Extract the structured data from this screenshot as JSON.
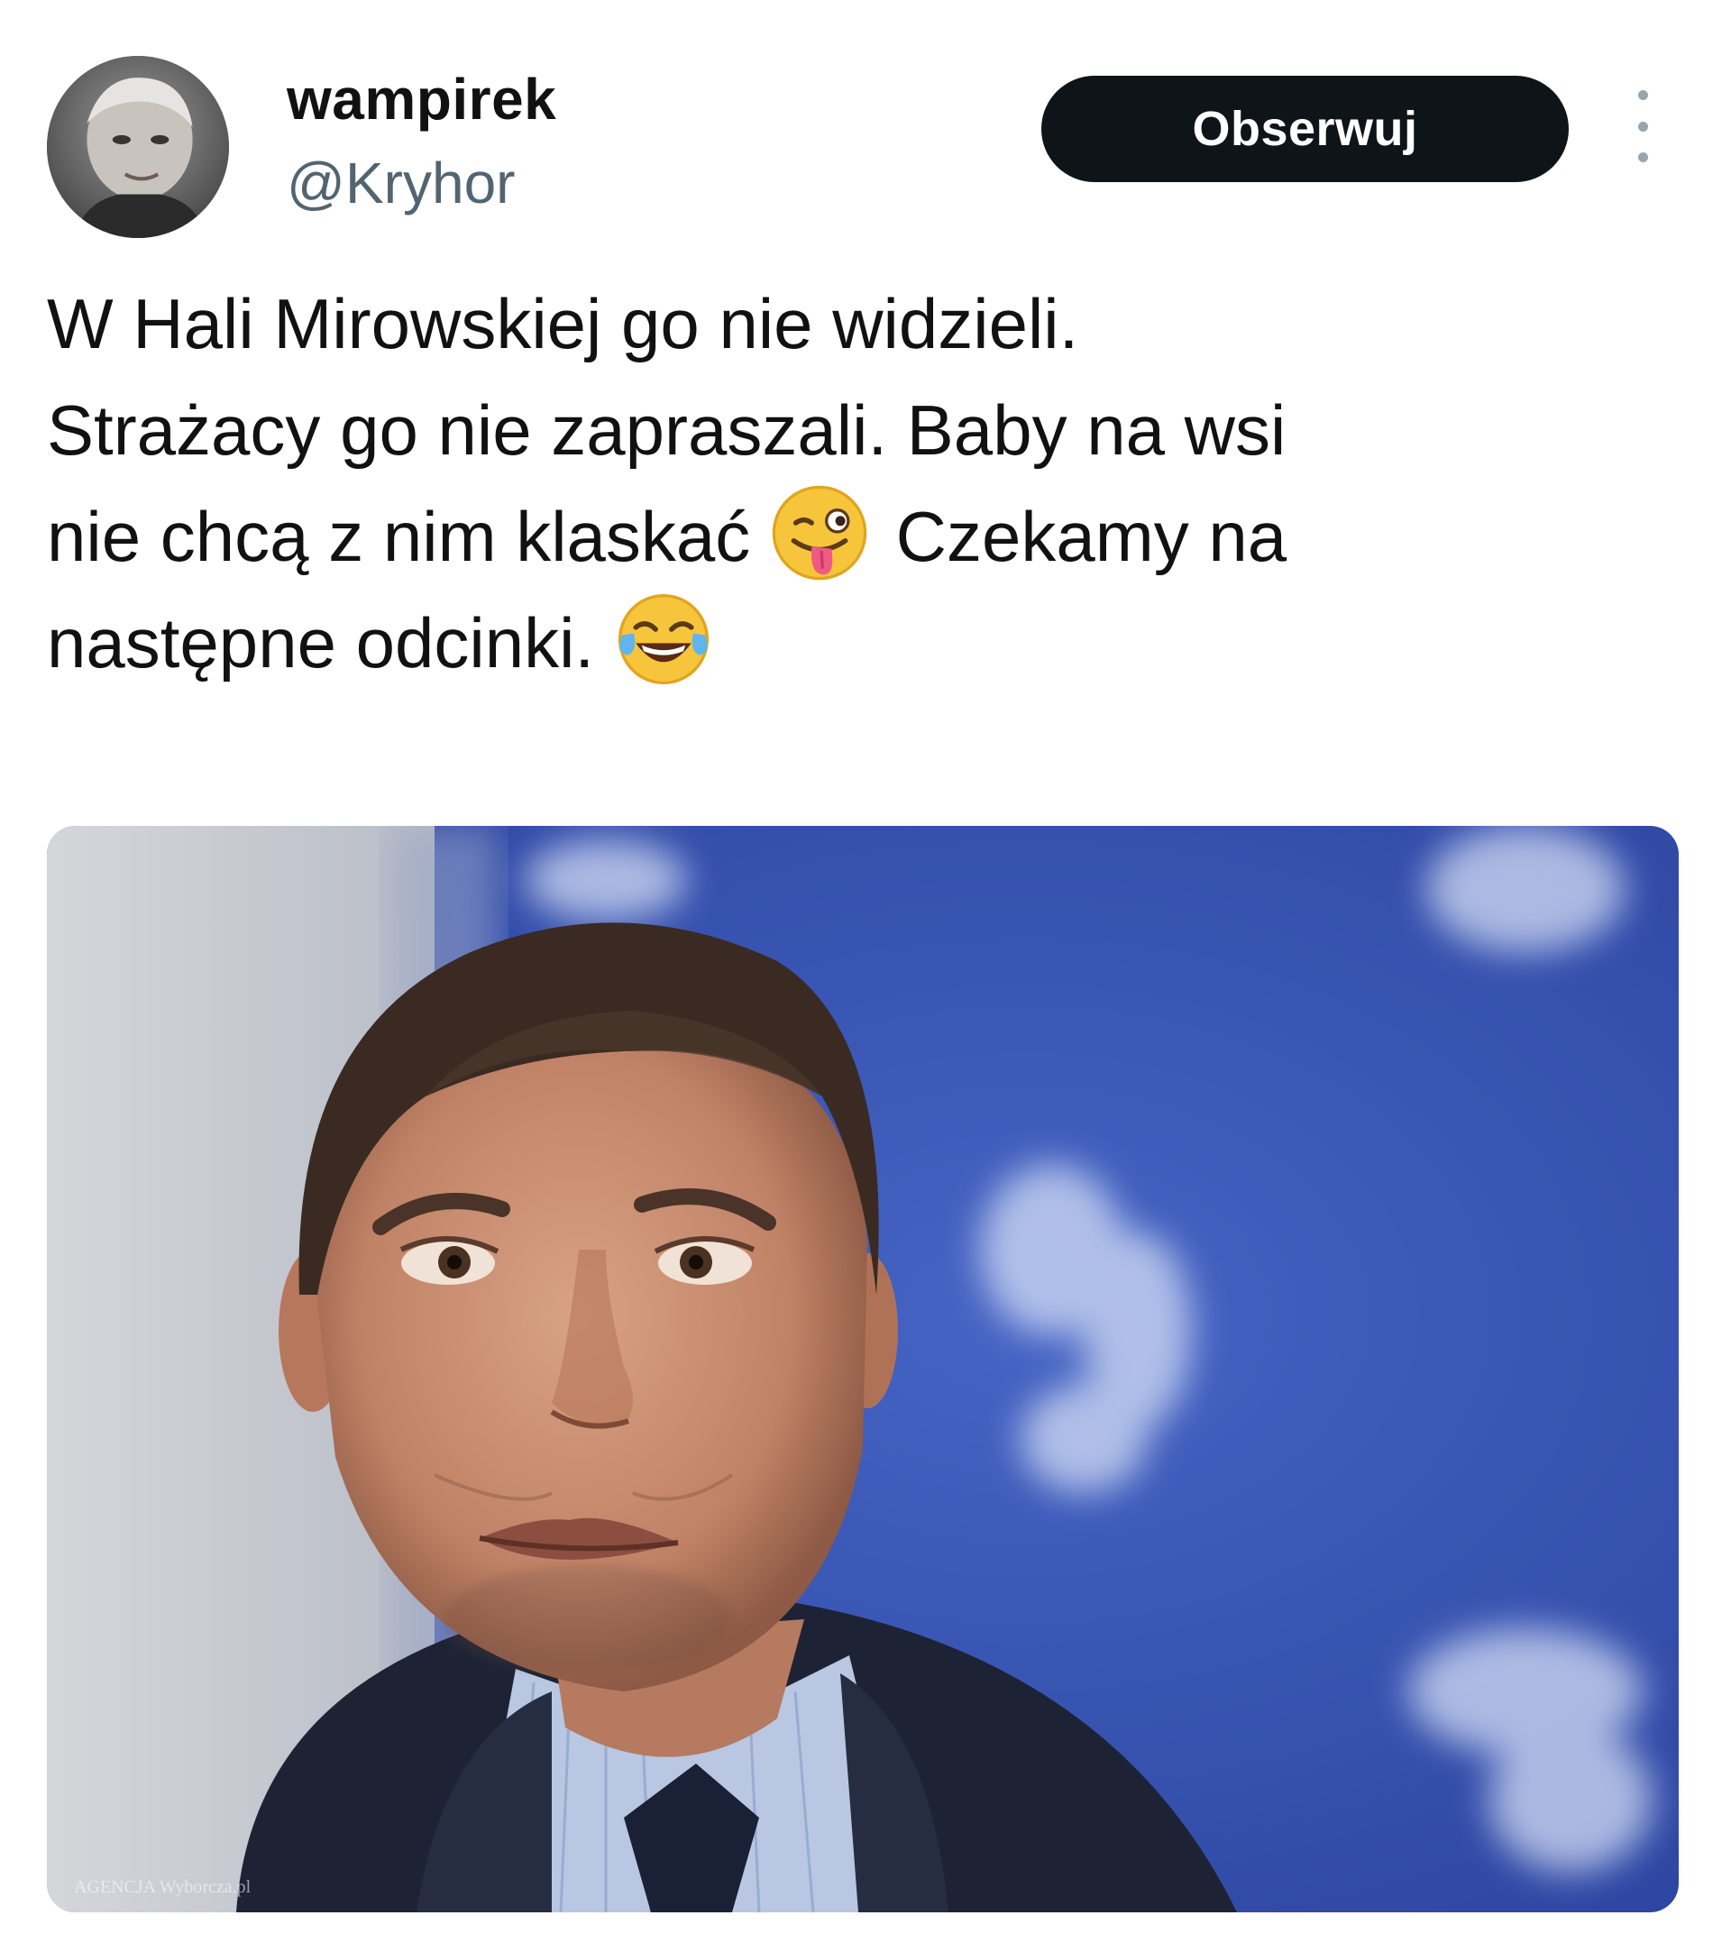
{
  "author": {
    "display_name": "wampirek",
    "handle": "@Kryhor"
  },
  "actions": {
    "follow_label": "Obserwuj",
    "more_icon": "vertical-ellipsis-icon"
  },
  "tweet": {
    "line_1": "W Hali Mirowskiej go nie widzieli.",
    "line_2": "Strażacy go nie zapraszali. Baby na wsi",
    "line_3_before_emoji": "nie chcą z nim klaskać",
    "emoji_1": "winking-face-with-tongue-emoji",
    "line_3_after_emoji": " Czekamy na",
    "line_4": "następne odcinki.",
    "emoji_2": "face-with-tears-of-joy-emoji"
  },
  "media": {
    "image": "photo-man-in-suit-blue-background",
    "watermark": "AGENCJA Wyborcza.pl"
  },
  "colors": {
    "follow_bg": "#0f1419",
    "handle_text": "#536471",
    "photo_background_blue": "#3a56b5"
  }
}
